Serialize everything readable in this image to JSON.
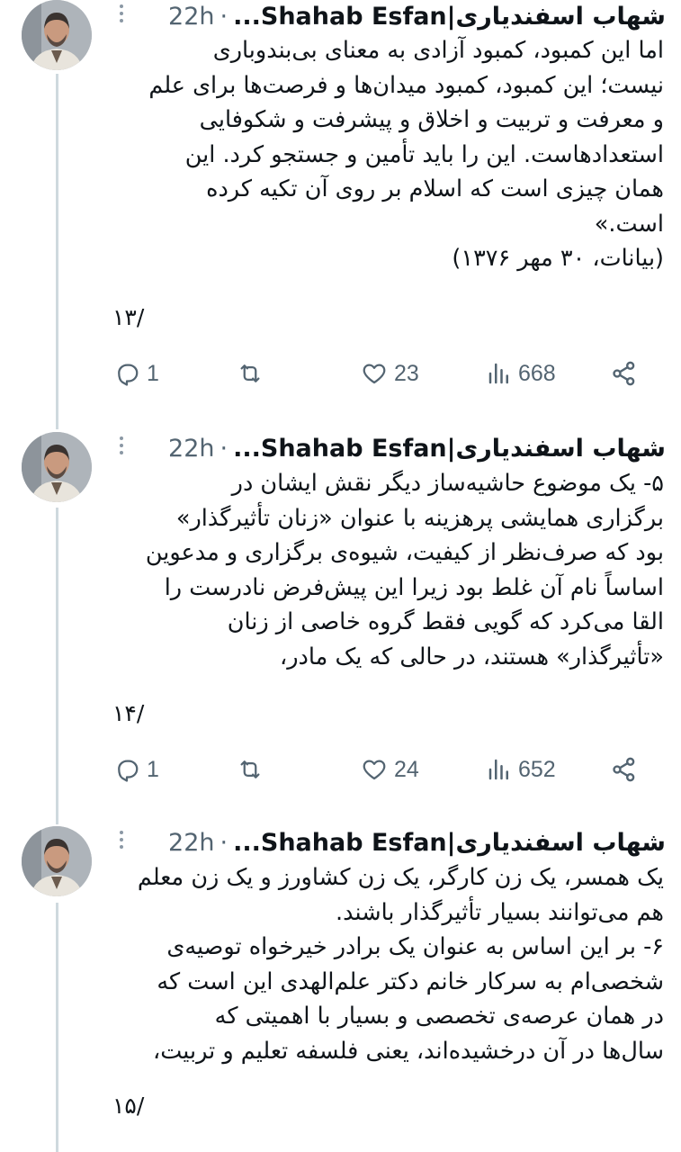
{
  "tweets": [
    {
      "name": "شهاب اسفندیاری|Shahab Esfan...",
      "separator": "·",
      "time": "22h",
      "lines": [
        "اما این کمبود، کمبود آزادی به معنای بی‌بندوباری",
        "نیست؛ این کمبود، کمبود میدان‌ها و فرصت‌ها برای علم",
        "و معرفت و تربیت و اخلاق و پیشرفت و شکوفایی",
        "استعدادهاست. این را باید تأمین و جستجو کرد. این",
        "همان چیزی است که اسلام بر روی آن تکیه کرده",
        "است.»",
        "(بیانات، ۳۰ مهر ۱۳۷۶)"
      ],
      "counter": "۱۳/",
      "replies": "1",
      "reposts": "",
      "likes": "23",
      "views": "668"
    },
    {
      "name": "شهاب اسفندیاری|Shahab Esfan...",
      "separator": "·",
      "time": "22h",
      "lines": [
        "۵- یک موضوع حاشیه‌ساز دیگر نقش ایشان در",
        "برگزاری همایشی پرهزینه با عنوان «زنان تأثیرگذار»",
        "بود که صرف‌نظر از کیفیت، شیوه‌ی برگزاری و مدعوین",
        "اساساً نام آن غلط بود زیرا این پیش‌فرض نادرست را",
        "القا می‌کرد که گویی فقط گروه خاصی از زنان",
        "«تأثیرگذار» هستند، در حالی که یک مادر،"
      ],
      "counter": "۱۴/",
      "replies": "1",
      "reposts": "",
      "likes": "24",
      "views": "652"
    },
    {
      "name": "شهاب اسفندیاری|Shahab Esfan...",
      "separator": "·",
      "time": "22h",
      "lines": [
        "یک همسر، یک زن کارگر، یک زن کشاورز و یک زن معلم",
        "هم می‌توانند بسیار تأثیرگذار باشند.",
        "۶- بر این اساس به عنوان یک برادر خیرخواه توصیه‌ی",
        "شخصی‌ام به سرکار خانم دکتر علم‌الهدی این است که",
        "در همان عرصه‌ی تخصصی و بسیار با اهمیتی که",
        "سال‌ها در آن درخشیده‌اند، یعنی فلسفه تعلیم و تربیت،"
      ],
      "counter": "۱۵/"
    }
  ],
  "icons": {
    "reply": "reply-icon",
    "repost": "repost-icon",
    "like": "like-icon",
    "views": "views-icon",
    "share": "share-icon",
    "more": "more-icon"
  },
  "colors": {
    "text": "#0f1419",
    "secondary": "#536471",
    "thread_line": "#cfd9de"
  }
}
